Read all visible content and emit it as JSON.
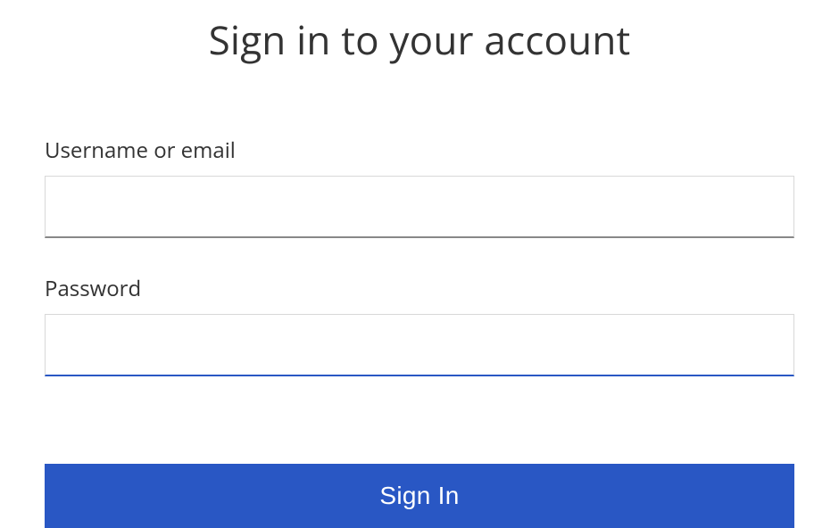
{
  "header": {
    "title": "Sign in to your account"
  },
  "form": {
    "username": {
      "label": "Username or email",
      "value": ""
    },
    "password": {
      "label": "Password",
      "value": ""
    },
    "submit_label": "Sign In"
  },
  "colors": {
    "accent": "#2957c4",
    "text": "#333333",
    "input_border": "#d8d8d8",
    "input_bottom": "#888888"
  }
}
